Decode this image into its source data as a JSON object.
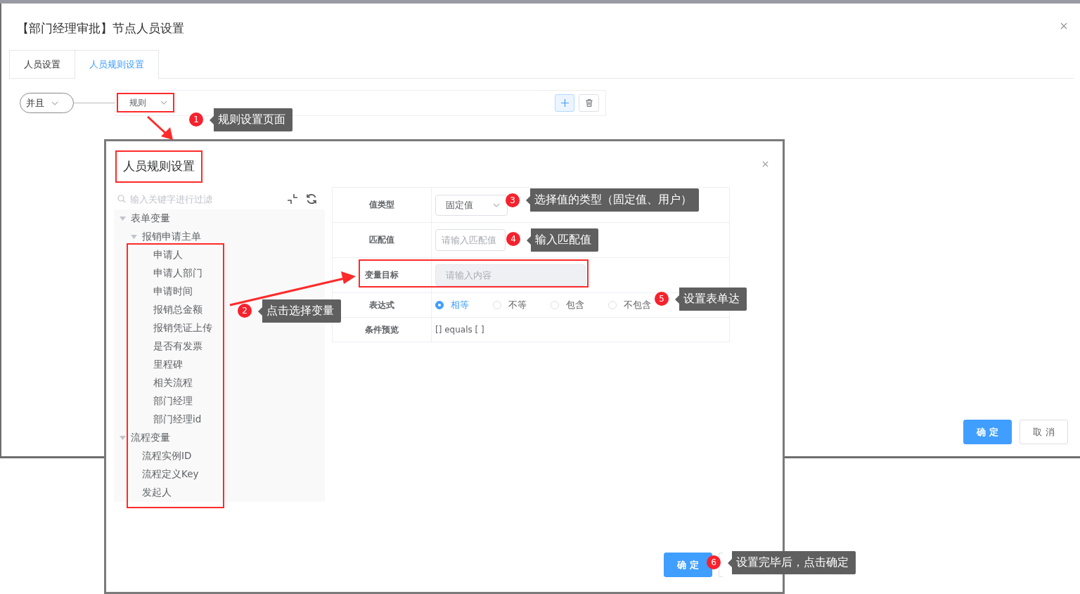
{
  "outer_dialog": {
    "title": "【部门经理审批】节点人员设置",
    "tabs": [
      {
        "label": "人员设置",
        "selected": false
      },
      {
        "label": "人员规则设置",
        "selected": true
      }
    ],
    "logic_select": {
      "value": "并且"
    },
    "rule_select": {
      "value": "规则"
    },
    "buttons": [
      {
        "label": "确 定",
        "kind": "primary"
      },
      {
        "label": "取 消",
        "kind": "default"
      }
    ]
  },
  "inner_dialog": {
    "title": "人员规则设置",
    "filter": {
      "placeholder": "输入关键字进行过滤"
    },
    "tree": [
      {
        "label": "表单变量",
        "expanded": true,
        "children": [
          {
            "label": "报销申请主单",
            "expanded": true,
            "children": [
              {
                "label": "申请人"
              },
              {
                "label": "申请人部门"
              },
              {
                "label": "申请时间"
              },
              {
                "label": "报销总金额"
              },
              {
                "label": "报销凭证上传"
              },
              {
                "label": "是否有发票"
              },
              {
                "label": "里程碑"
              },
              {
                "label": "相关流程"
              },
              {
                "label": "部门经理"
              },
              {
                "label": "部门经理id"
              }
            ]
          }
        ]
      },
      {
        "label": "流程变量",
        "expanded": true,
        "children": [
          {
            "label": "流程实例ID"
          },
          {
            "label": "流程定义Key"
          },
          {
            "label": "发起人"
          }
        ]
      }
    ],
    "form": [
      {
        "label": "值类型",
        "kind": "select",
        "value": "固定值"
      },
      {
        "label": "匹配值",
        "kind": "input",
        "placeholder": "请输入匹配值",
        "disabled": false
      },
      {
        "label": "变量目标",
        "kind": "input",
        "placeholder": "请输入内容",
        "disabled": true
      },
      {
        "label": "表达式",
        "kind": "radio",
        "options": [
          {
            "label": "相等",
            "selected": true
          },
          {
            "label": "不等",
            "selected": false
          },
          {
            "label": "包含",
            "selected": false
          },
          {
            "label": "不包含",
            "selected": false
          }
        ]
      },
      {
        "label": "条件预览",
        "kind": "text",
        "value": "[] equals [ ]"
      }
    ],
    "buttons": [
      {
        "label": "确 定",
        "kind": "primary"
      }
    ]
  },
  "annotations": [
    {
      "number": "1",
      "text": "规则设置页面"
    },
    {
      "number": "2",
      "text": "点击选择变量"
    },
    {
      "number": "3",
      "text": "选择值的类型（固定值、用户）"
    },
    {
      "number": "4",
      "text": "输入匹配值"
    },
    {
      "number": "5",
      "text": "设置表单达"
    },
    {
      "number": "6",
      "text": "设置完毕后，点击确定"
    }
  ]
}
